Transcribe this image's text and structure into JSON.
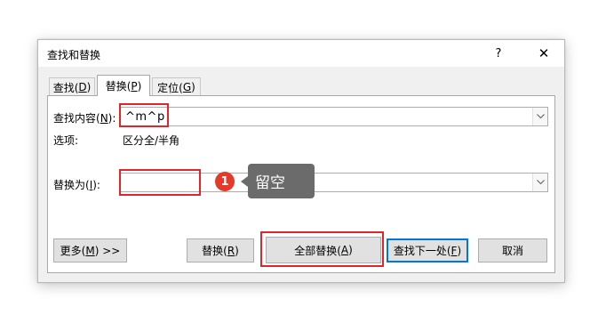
{
  "dialog": {
    "title": "查找和替换",
    "help": "?",
    "close": "✕"
  },
  "tabs": [
    {
      "label": "查找(",
      "key": "D",
      "end": ")",
      "active": false
    },
    {
      "label": "替换(",
      "key": "P",
      "end": ")",
      "active": true
    },
    {
      "label": "定位(",
      "key": "G",
      "end": ")",
      "active": false
    }
  ],
  "find": {
    "label": "查找内容(",
    "key": "N",
    "end": "):",
    "value": "^m^p"
  },
  "options": {
    "label": "选项:",
    "value": "区分全/半角"
  },
  "replace": {
    "label": "替换为(",
    "key": "I",
    "end": "):",
    "value": ""
  },
  "buttons": {
    "more": {
      "label": "更多(",
      "key": "M",
      "end": ") >>"
    },
    "replace": {
      "label": "替换(",
      "key": "R",
      "end": ")"
    },
    "replace_all": {
      "label": "全部替换(",
      "key": "A",
      "end": ")"
    },
    "find_next": {
      "label": "查找下一处(",
      "key": "F",
      "end": ")"
    },
    "cancel": {
      "label": "取消"
    }
  },
  "annotation": {
    "number": "1",
    "text": "留空",
    "highlight_color": "#e0262b",
    "badge_color": "#e53a2b",
    "callout_color": "#6b6b6b"
  }
}
